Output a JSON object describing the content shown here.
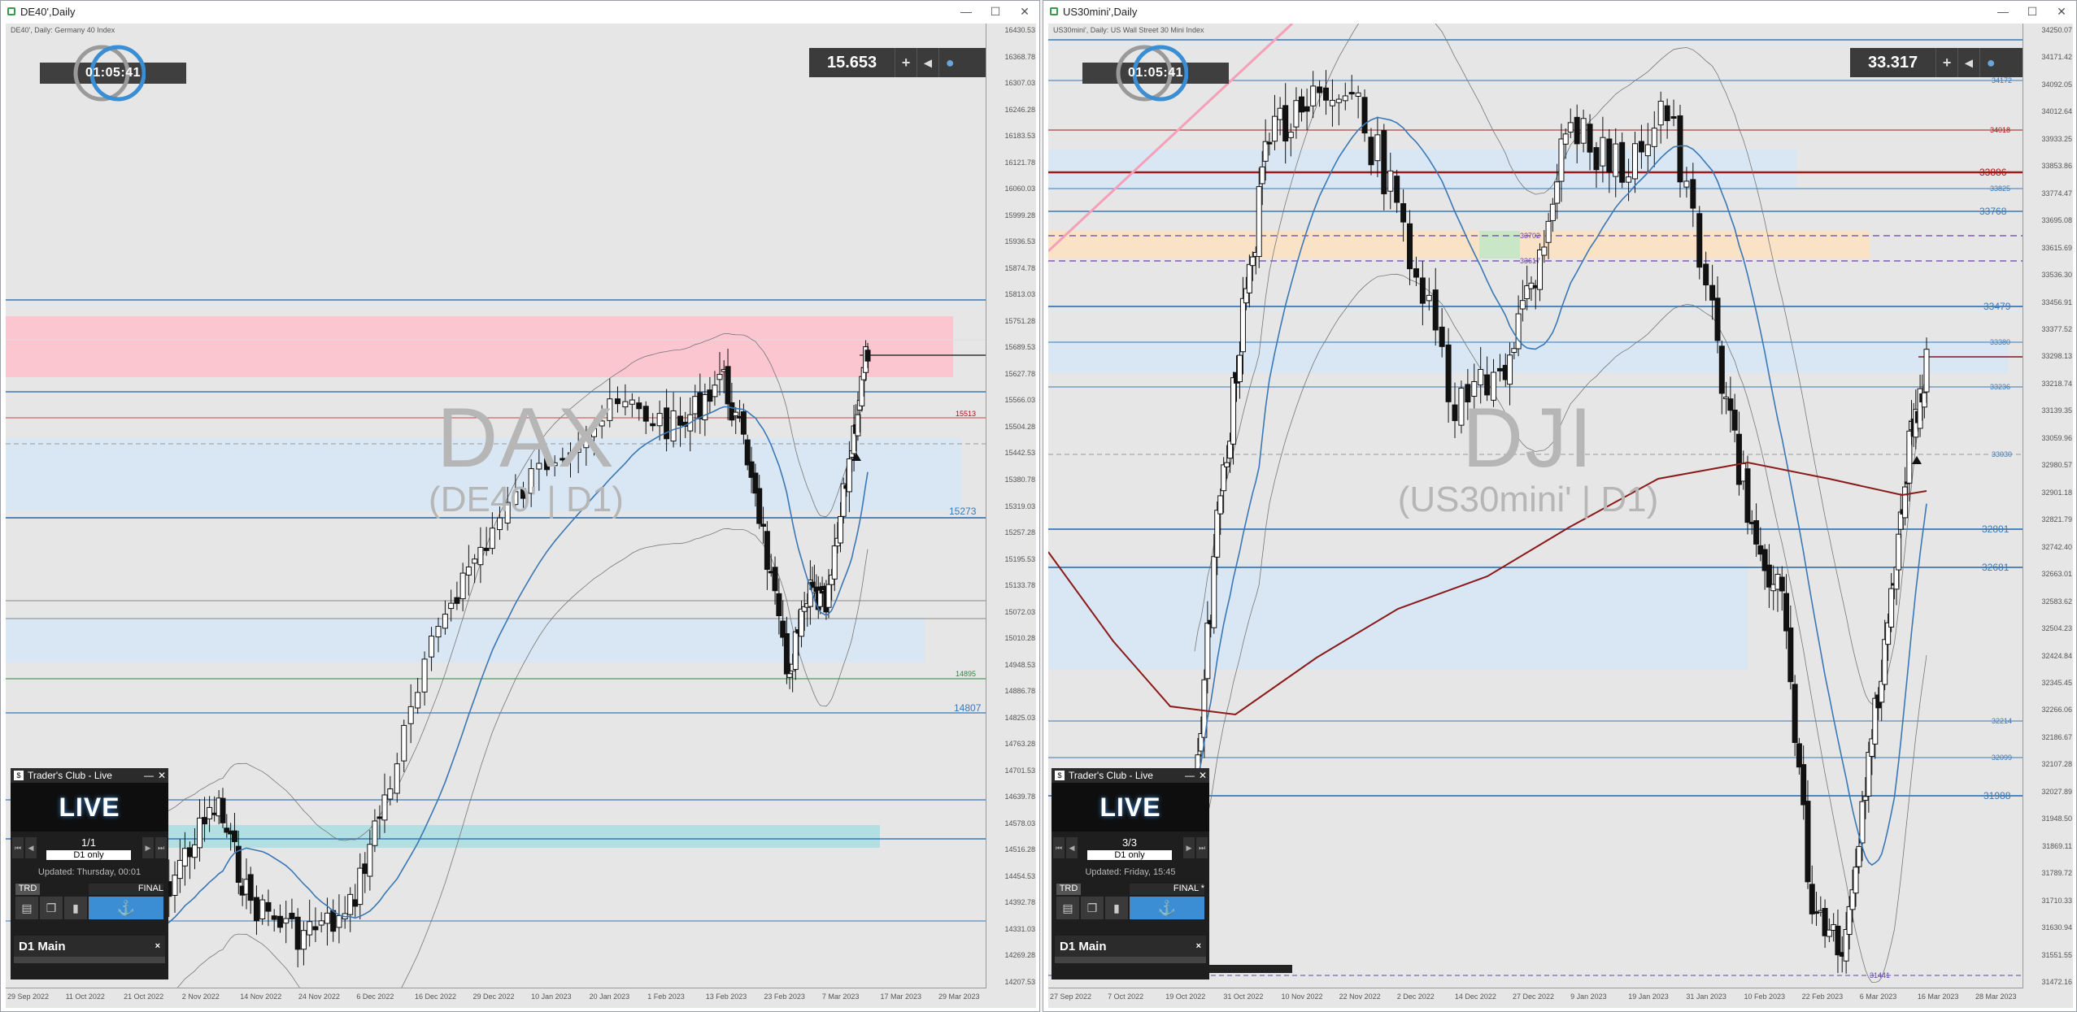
{
  "left_window": {
    "title": "DE40',Daily",
    "symbol_info": "DE40', Daily:  Germany 40 Index",
    "timer": "01:05:41",
    "price_box": {
      "value": "15.653",
      "plus_label": "+",
      "arrow_label": "◂"
    },
    "watermark": {
      "main": "DAX",
      "sub": "(DE40' | D1)"
    },
    "y_ticks": [
      "16430.53",
      "16368.78",
      "16307.03",
      "16246.28",
      "16183.53",
      "16121.78",
      "16060.03",
      "15999.28",
      "15936.53",
      "15874.78",
      "15813.03",
      "15751.28",
      "15689.53",
      "15627.78",
      "15566.03",
      "15504.28",
      "15442.53",
      "15380.78",
      "15319.03",
      "15257.28",
      "15195.53",
      "15133.78",
      "15072.03",
      "15010.28",
      "14948.53",
      "14886.78",
      "14825.03",
      "14763.28",
      "14701.53",
      "14639.78",
      "14578.03",
      "14516.28",
      "14454.53",
      "14392.78",
      "14331.03",
      "14269.28",
      "14207.53"
    ],
    "x_ticks": [
      "29 Sep 2022",
      "11 Oct 2022",
      "21 Oct 2022",
      "2 Nov 2022",
      "14 Nov 2022",
      "24 Nov 2022",
      "6 Dec 2022",
      "16 Dec 2022",
      "29 Dec 2022",
      "10 Jan 2023",
      "20 Jan 2023",
      "1 Feb 2023",
      "13 Feb 2023",
      "23 Feb 2023",
      "7 Mar 2023",
      "17 Mar 2023",
      "29 Mar 2023"
    ],
    "levels": [
      {
        "label": "15513",
        "color": "red"
      },
      {
        "label": "15273",
        "color": "blue"
      },
      {
        "label": "14895",
        "color": "green"
      },
      {
        "label": "14807",
        "color": "blue"
      }
    ],
    "panel": {
      "title": "Trader's Club - Live",
      "live_label": "LIVE",
      "page": "1/1",
      "tag": "D1 only",
      "updated": "Updated: Thursday, 00:01",
      "trd_label": "TRD",
      "final_label": "FINAL",
      "d1_label": "D1 Main",
      "close_label": "×"
    }
  },
  "right_window": {
    "title": "US30mini',Daily",
    "symbol_info": "US30mini', Daily:  US Wall Street 30 Mini Index",
    "timer": "01:05:41",
    "price_box": {
      "value": "33.317",
      "plus_label": "+",
      "arrow_label": "◂"
    },
    "watermark": {
      "main": "DJI",
      "sub": "(US30mini' | D1)"
    },
    "y_ticks": [
      "34250.07",
      "34171.42",
      "34092.05",
      "34012.64",
      "33933.25",
      "33853.86",
      "33774.47",
      "33695.08",
      "33615.69",
      "33536.30",
      "33456.91",
      "33377.52",
      "33298.13",
      "33218.74",
      "33139.35",
      "33059.96",
      "32980.57",
      "32901.18",
      "32821.79",
      "32742.40",
      "32663.01",
      "32583.62",
      "32504.23",
      "32424.84",
      "32345.45",
      "32266.06",
      "32186.67",
      "32107.28",
      "32027.89",
      "31948.50",
      "31869.11",
      "31789.72",
      "31710.33",
      "31630.94",
      "31551.55",
      "31472.16"
    ],
    "x_ticks": [
      "27 Sep 2022",
      "7 Oct 2022",
      "19 Oct 2022",
      "31 Oct 2022",
      "10 Nov 2022",
      "22 Nov 2022",
      "2 Dec 2022",
      "14 Dec 2022",
      "27 Dec 2022",
      "9 Jan 2023",
      "19 Jan 2023",
      "31 Jan 2023",
      "10 Feb 2023",
      "22 Feb 2023",
      "6 Mar 2023",
      "16 Mar 2023",
      "28 Mar 2023"
    ],
    "levels": [
      {
        "label": "34172",
        "color": "blue"
      },
      {
        "label": "34018",
        "color": "red"
      },
      {
        "label": "33886",
        "color": "red"
      },
      {
        "label": "33825",
        "color": "blue"
      },
      {
        "label": "33768",
        "color": "blue"
      },
      {
        "label": "33702",
        "color": "purple"
      },
      {
        "label": "33617",
        "color": "purple"
      },
      {
        "label": "33479",
        "color": "blue"
      },
      {
        "label": "33380",
        "color": "blue"
      },
      {
        "label": "33236",
        "color": "blue"
      },
      {
        "label": "33030",
        "color": "blue"
      },
      {
        "label": "32801",
        "color": "blue"
      },
      {
        "label": "32681",
        "color": "blue"
      },
      {
        "label": "32214",
        "color": "blue"
      },
      {
        "label": "32099",
        "color": "blue"
      },
      {
        "label": "31988",
        "color": "blue"
      },
      {
        "label": "31441",
        "color": "purple"
      }
    ],
    "panel": {
      "title": "Trader's Club - Live",
      "live_label": "LIVE",
      "page": "3/3",
      "tag": "D1 only",
      "updated": "Updated: Friday, 15:45",
      "trd_label": "TRD",
      "final_label": "FINAL *",
      "d1_label": "D1 Main",
      "close_label": "×"
    }
  },
  "window_buttons": {
    "minimize": "—",
    "maximize": "☐",
    "close": "✕"
  },
  "colors": {
    "chart_bg": "#e6e6e6",
    "level_blue": "#3a78b5",
    "level_red": "#a11a1a",
    "zone_pink": "#ffc0cb",
    "zone_blue": "#d6e6f6",
    "zone_teal": "#a8dde0",
    "zone_orange": "#fde0c0",
    "accent_blue": "#3c8ed4"
  }
}
